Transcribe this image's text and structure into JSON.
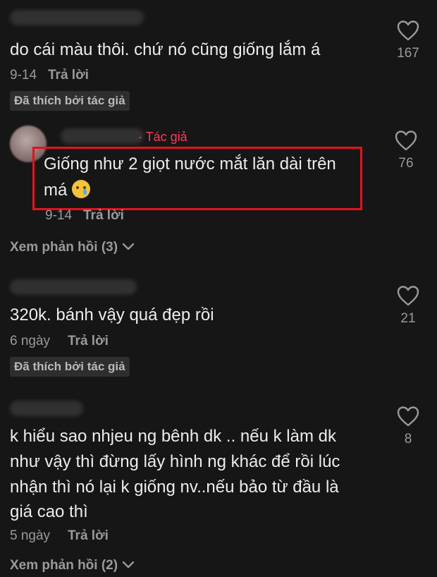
{
  "comments": [
    {
      "text_lines": [
        "do cái màu thôi. chứ nó cũng giống lắm á"
      ],
      "date": "9-14",
      "reply_label": "Trả lời",
      "badge": "Đã thích bởi tác giả",
      "likes": "167"
    },
    {
      "author_tag": "· Tác giả",
      "text_lines": [
        "Giống như 2 giọt nước mắt lăn dài trên",
        "má"
      ],
      "emoji_icon": "crying-face-emoji",
      "date": "9-14",
      "reply_label": "Trả lời",
      "likes": "76",
      "highlight_color": "#e3121b"
    },
    {
      "text_lines": [
        "320k. bánh vậy quá đẹp rồi"
      ],
      "date": "6 ngày",
      "reply_label": "Trả lời",
      "badge": "Đã thích bởi tác giả",
      "likes": "21"
    },
    {
      "text_lines": [
        "k hiểu sao nhjeu ng bênh dk .. nếu k làm dk",
        "như vậy thì đừng lấy hình ng khác để rồi lúc",
        "nhận thì nó lại k giống nv..nếu bảo từ đầu là",
        "giá cao thì"
      ],
      "date": "5 ngày",
      "reply_label": "Trả lời",
      "likes": "8"
    }
  ],
  "view_replies": [
    {
      "label": "Xem phản hồi (3)"
    },
    {
      "label": "Xem phản hồi (2)"
    }
  ],
  "colors": {
    "background": "#161616",
    "text": "#ececec",
    "muted": "#9a9a9a",
    "author_tag": "#ff3b5c"
  }
}
